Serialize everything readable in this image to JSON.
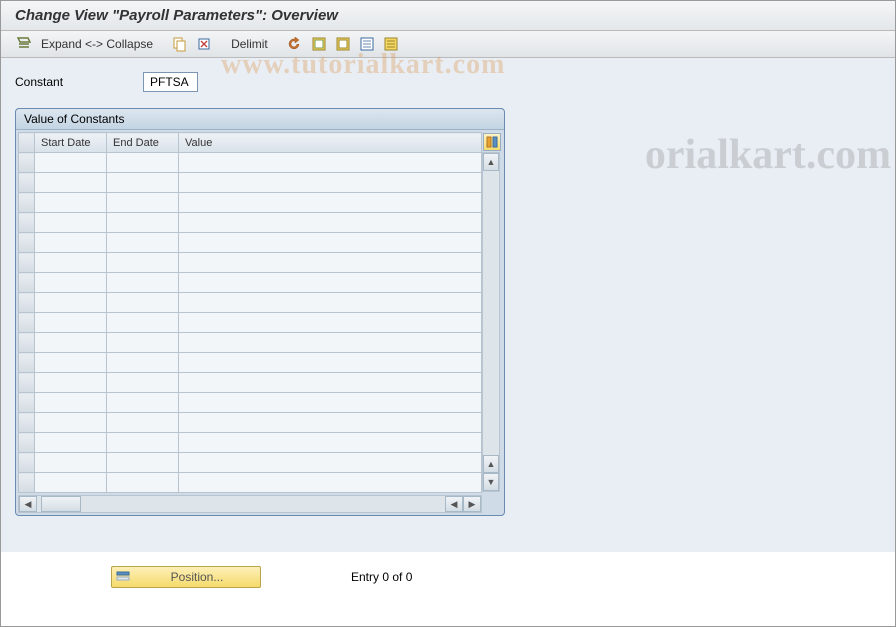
{
  "title": "Change View \"Payroll Parameters\": Overview",
  "toolbar": {
    "expand_collapse": "Expand <-> Collapse",
    "delimit": "Delimit"
  },
  "field": {
    "constant_label": "Constant",
    "constant_value": "PFTSA"
  },
  "panel": {
    "title": "Value of Constants",
    "columns": [
      "Start Date",
      "End Date",
      "Value"
    ],
    "rows": [
      "",
      "",
      "",
      "",
      "",
      "",
      "",
      "",
      "",
      "",
      "",
      "",
      "",
      "",
      "",
      "",
      ""
    ]
  },
  "footer": {
    "position_label": "Position...",
    "entry_text": "Entry 0 of 0"
  },
  "watermark_a": "www.tutorialkart.com",
  "watermark_b": "orialkart.com"
}
